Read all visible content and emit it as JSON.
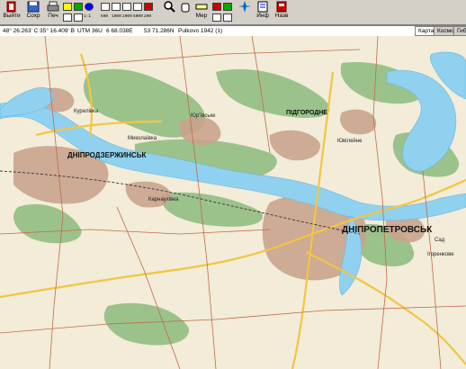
{
  "toolbar": {
    "exit_label": "Выйти",
    "save_label": "Сохр",
    "print_label": "Печ",
    "zoom_label": "1:1",
    "scale_labels": [
      "500",
      "1000",
      "2000",
      "5000",
      "200"
    ],
    "map_label": "Мер",
    "info_label": "Инф",
    "help_label": "Назв"
  },
  "status": {
    "lat": "48° 26.263' C",
    "lon": "35° 16.409' В",
    "utm": "UTM 36U",
    "easting": "6 68.038E",
    "northing": "53 71.286N",
    "datum": "Pulkovo 1942 (1)"
  },
  "tabs": [
    "Карта",
    "Космос",
    "Гибрид"
  ],
  "map": {
    "cities": {
      "dnipropetrovsk": "ДНІПРОПЕТРОВСЬК",
      "dniprodzerzhinsk": "ДНІПРОДЗЕРЖИНСЬК",
      "pidgorodne": "ПІДГОРОДНЕ"
    },
    "towns": {
      "kurylivka": "Курилівка",
      "mykolaivka": "Миколаївка",
      "yurivske": "Юр'ївське",
      "karnaukhivka": "Карнаухівка",
      "kruchshivka": "Ювілейне",
      "sad": "Сад",
      "ivanivka": "Ігоренкове"
    }
  },
  "colors": {
    "river": "#8fd1ef",
    "forest": "#9bc28b",
    "urban": "#c9a48e",
    "road_major": "#f4c542",
    "road_minor": "#c26a4a",
    "background": "#f2ecd8"
  }
}
